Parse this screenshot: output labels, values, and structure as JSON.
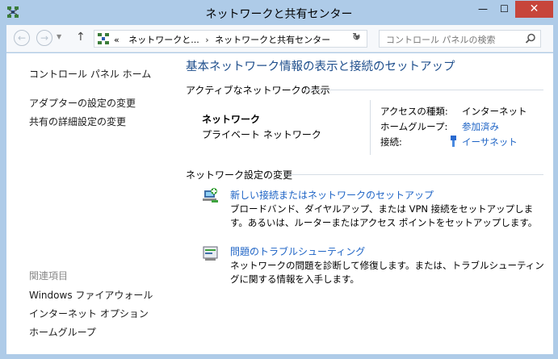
{
  "window": {
    "title": "ネットワークと共有センター",
    "minimize": "—",
    "maximize": "☐",
    "close": "✕"
  },
  "navbar": {
    "back": "←",
    "forward": "→",
    "up": "↑",
    "breadcrumb_prefix": "«",
    "breadcrumb_1": "ネットワークと...",
    "breadcrumb_sep": "›",
    "breadcrumb_2": "ネットワークと共有センター",
    "search_placeholder": "コントロール パネルの検索"
  },
  "sidebar": {
    "home": "コントロール パネル ホーム",
    "adapter": "アダプターの設定の変更",
    "sharing": "共有の詳細設定の変更",
    "related_head": "関連項目",
    "firewall": "Windows ファイアウォール",
    "internet_options": "インターネット オプション",
    "homegroup": "ホームグループ"
  },
  "main": {
    "title": "基本ネットワーク情報の表示と接続のセットアップ",
    "active_head": "アクティブなネットワークの表示",
    "network_name": "ネットワーク",
    "network_type": "プライベート ネットワーク",
    "access_label": "アクセスの種類:",
    "access_value": "インターネット",
    "homegroup_label": "ホームグループ:",
    "homegroup_value": "参加済み",
    "connection_label": "接続:",
    "connection_value": "イーサネット",
    "change_head": "ネットワーク設定の変更",
    "task1_link": "新しい接続またはネットワークのセットアップ",
    "task1_desc": "ブロードバンド、ダイヤルアップ、または VPN 接続をセットアップします。あるいは、ルーターまたはアクセス ポイントをセットアップします。",
    "task2_link": "問題のトラブルシューティング",
    "task2_desc": "ネットワークの問題を診断して修復します。または、トラブルシューティングに関する情報を入手します。"
  },
  "colors": {
    "accent_link": "#1d63c5",
    "title_blue": "#1e4e8c",
    "frame": "#aecbe8",
    "close_red": "#c7453b"
  }
}
